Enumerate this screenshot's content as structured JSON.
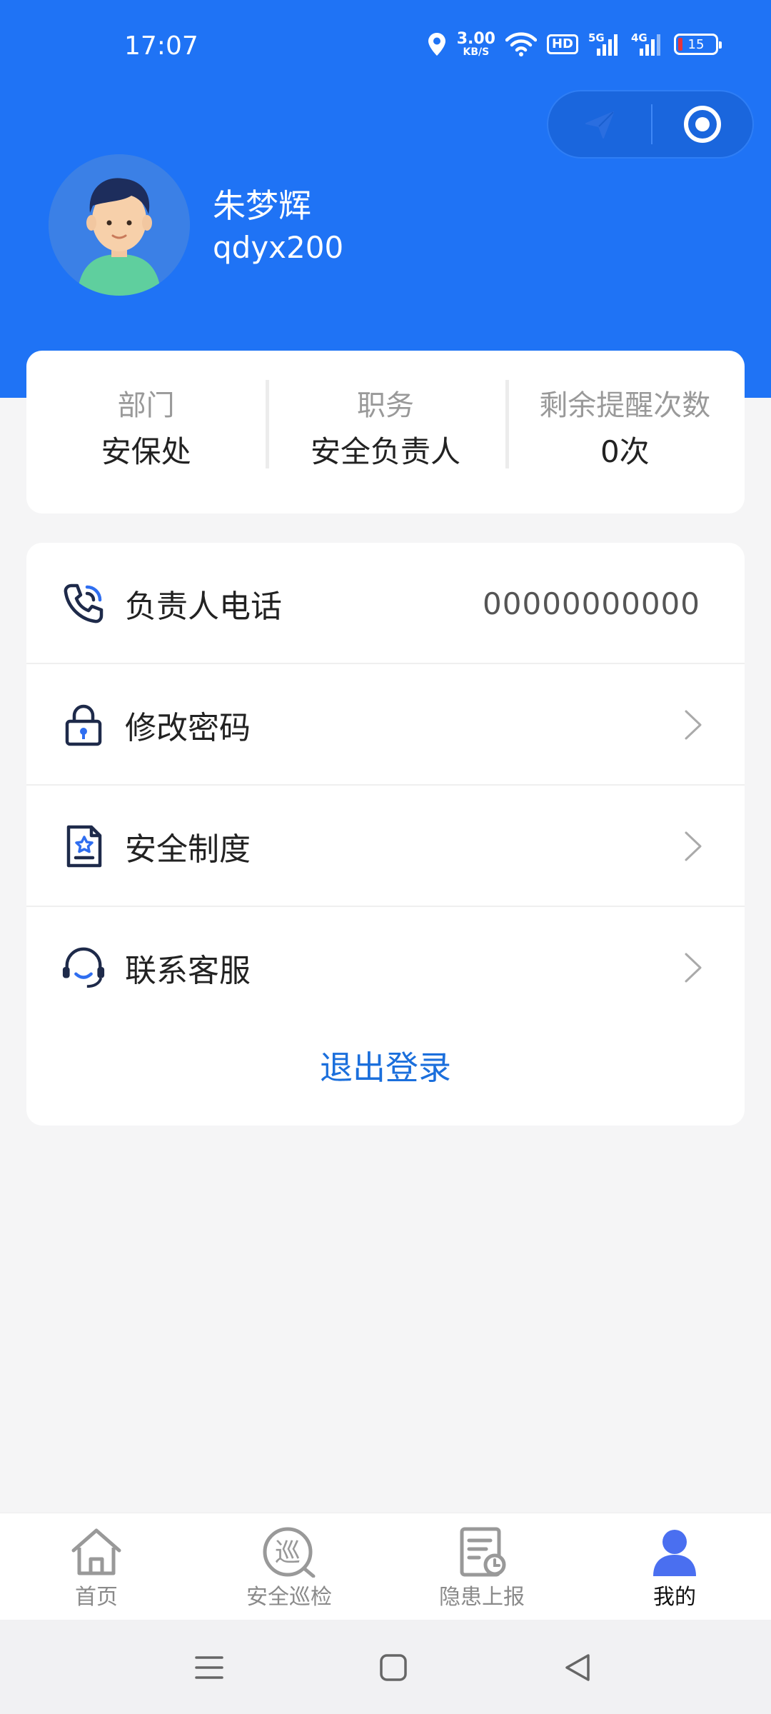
{
  "status_bar": {
    "time": "17:07",
    "net_speed_value": "3.00",
    "net_speed_unit": "KB/S",
    "hd_label": "HD",
    "signal_5g": "5G",
    "signal_4g": "4G",
    "battery": "15"
  },
  "profile": {
    "name": "朱梦辉",
    "user_id": "qdyx200"
  },
  "info": [
    {
      "label": "部门",
      "value": "安保处"
    },
    {
      "label": "职务",
      "value": "安全负责人"
    },
    {
      "label": "剩余提醒次数",
      "value": "0次"
    }
  ],
  "menu": {
    "phone": {
      "label": "负责人电话",
      "value": "00000000000",
      "icon": "phone-icon"
    },
    "password": {
      "label": "修改密码",
      "icon": "lock-icon"
    },
    "rules": {
      "label": "安全制度",
      "icon": "document-star-icon"
    },
    "service": {
      "label": "联系客服",
      "icon": "headset-icon"
    },
    "logout": "退出登录"
  },
  "tabbar": {
    "items": [
      {
        "label": "首页",
        "icon": "home-icon"
      },
      {
        "label": "安全巡检",
        "icon": "patrol-icon"
      },
      {
        "label": "隐患上报",
        "icon": "report-icon"
      },
      {
        "label": "我的",
        "icon": "user-icon",
        "active": true
      }
    ]
  },
  "colors": {
    "primary": "#1f73f5",
    "logout": "#1b6fdc",
    "tab_active": "#4a6ff0"
  }
}
